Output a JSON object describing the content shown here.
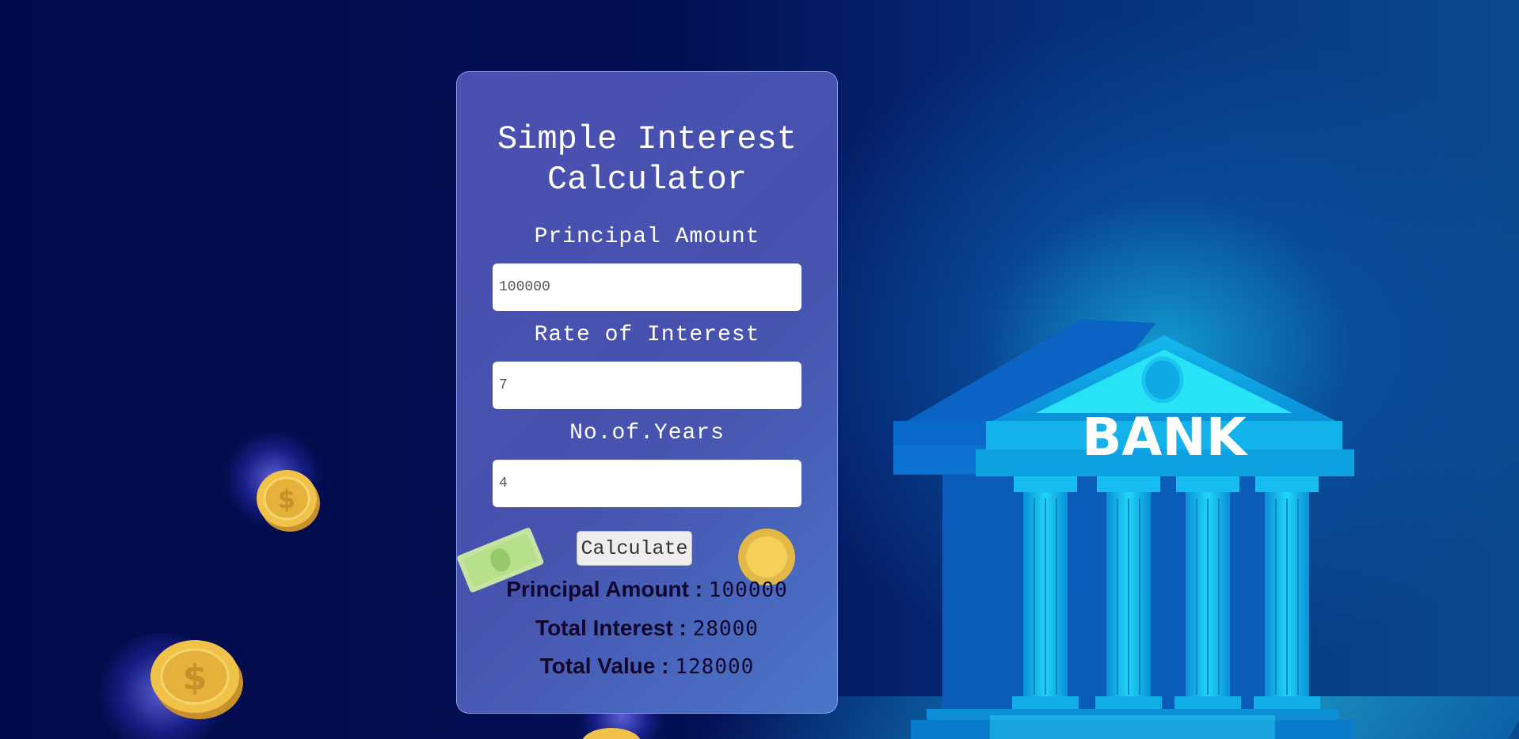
{
  "app": {
    "title": "Simple Interest Calculator"
  },
  "form": {
    "principal": {
      "label": "Principal Amount",
      "value": "100000"
    },
    "rate": {
      "label": "Rate of Interest",
      "value": "7"
    },
    "years": {
      "label": "No.of.Years",
      "value": "4"
    },
    "calculate_label": "Calculate"
  },
  "results": {
    "principal": {
      "label": "Principal Amount :",
      "value": "100000"
    },
    "interest": {
      "label": "Total Interest :",
      "value": "28000"
    },
    "total": {
      "label": "Total Value :",
      "value": "128000"
    }
  },
  "illustration": {
    "bank_sign": "BANK"
  },
  "colors": {
    "background": "#020b4a",
    "card": "#4a52b0",
    "bank_cyan": "#1fd3f0",
    "coin_gold": "#e8b43a"
  }
}
